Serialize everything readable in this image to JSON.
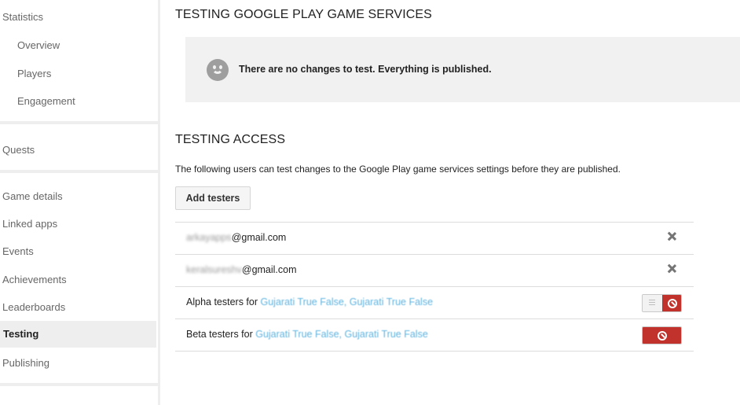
{
  "sidebar": {
    "items": [
      {
        "label": "Statistics"
      },
      {
        "label": "Overview"
      },
      {
        "label": "Players"
      },
      {
        "label": "Engagement"
      },
      {
        "label": "Quests"
      },
      {
        "label": "Game details"
      },
      {
        "label": "Linked apps"
      },
      {
        "label": "Events"
      },
      {
        "label": "Achievements"
      },
      {
        "label": "Leaderboards"
      },
      {
        "label": "Testing"
      },
      {
        "label": "Publishing"
      }
    ],
    "active": "Testing"
  },
  "main": {
    "title": "TESTING GOOGLE PLAY GAME SERVICES",
    "notice": "There are no changes to test. Everything is published.",
    "access_title": "TESTING ACCESS",
    "access_desc": "The following users can test changes to the Google Play game services settings before they are published.",
    "add_button": "Add testers",
    "testers": [
      {
        "blurred": "arkayapps",
        "domain": "@gmail.com"
      },
      {
        "blurred": "keralsureshv",
        "domain": "@gmail.com"
      }
    ],
    "groups": [
      {
        "label": "Alpha testers for ",
        "link": "Gujarati True False, Gujarati True False",
        "state": "partial"
      },
      {
        "label": "Beta testers for ",
        "link": "Gujarati True False, Gujarati True False",
        "state": "disabled"
      }
    ]
  },
  "colors": {
    "accent_red": "#c0322b",
    "link": "#5fb4e0",
    "active_bg": "#eeeeee"
  }
}
